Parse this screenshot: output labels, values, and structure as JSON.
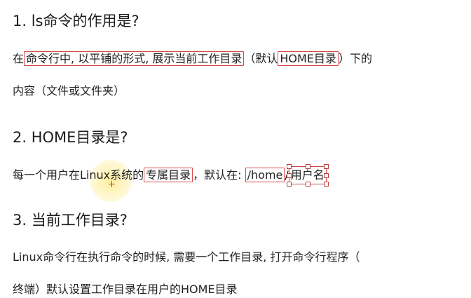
{
  "sections": [
    {
      "heading": "1. ls命令的作用是?",
      "line1_a": "在",
      "line1_box1": "命令行中, 以平铺的形式, 展示当前工作目录",
      "line1_b": "（默认",
      "line1_box2": "HOME目录",
      "line1_c": "）下的",
      "line2": "内容（文件或文件夹）"
    },
    {
      "heading": "2. HOME目录是?",
      "line1_a": "每一个用户在",
      "line1_linux": "Linux",
      "line1_b": "系统的",
      "line1_box1": "专属目录",
      "line1_c": "，默认在: ",
      "line1_box2": "/home",
      "line1_sep": "/",
      "line1_box3": "用户名"
    },
    {
      "heading": "3. 当前工作目录?",
      "line1": "Linux命令行在执行命令的时候, 需要一个工作目录, 打开命令行程序（",
      "line2": "终端）默认设置工作目录在用户的HOME目录"
    }
  ],
  "colors": {
    "annotation": "#d64a4a",
    "cursor_highlight": "#ffe98c"
  }
}
